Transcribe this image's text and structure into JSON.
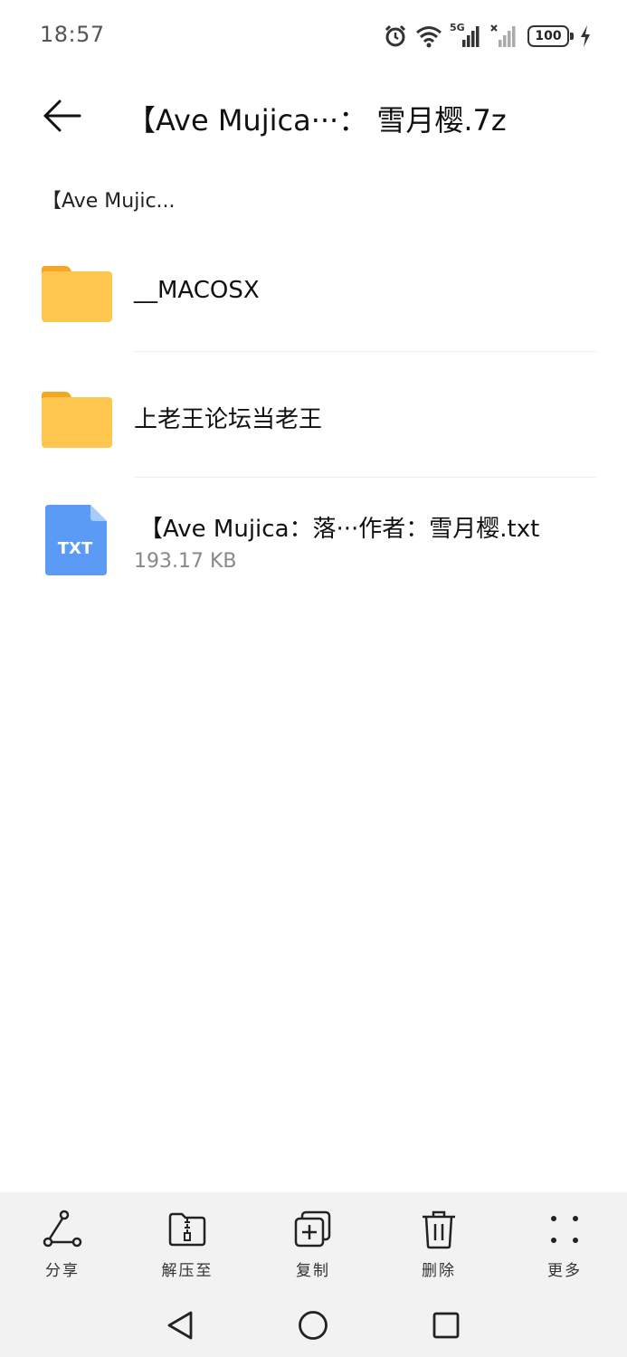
{
  "status_bar": {
    "time": "18:57",
    "network_label": "5G",
    "battery_level": "100",
    "icons": [
      "alarm-icon",
      "wifi-icon",
      "signal-5g-icon",
      "signal-no-service-icon",
      "battery-icon",
      "charging-icon"
    ]
  },
  "header": {
    "back_icon": "arrow-left-icon",
    "title": "【Ave Mujica···： 雪月樱.7z"
  },
  "breadcrumb": {
    "path": "【Ave Mujic..."
  },
  "files": [
    {
      "type": "folder",
      "icon": "folder-icon",
      "name": "__MACOSX"
    },
    {
      "type": "folder",
      "icon": "folder-icon",
      "name": "上老王论坛当老王"
    },
    {
      "type": "file",
      "icon": "txt-file-icon",
      "icon_label": "TXT",
      "name": "【Ave Mujica：落···作者：雪月樱.txt",
      "size": "193.17 KB"
    }
  ],
  "toolbar": {
    "share": "分享",
    "extract": "解压至",
    "copy": "复制",
    "delete": "删除",
    "more": "更多"
  },
  "navbar": {
    "icons": [
      "back-triangle-icon",
      "home-circle-icon",
      "recents-square-icon"
    ]
  },
  "colors": {
    "folder": "#FFC64F",
    "folder_tab": "#F5A623",
    "txt_icon": "#5B9BF5",
    "toolbar_bg": "#F2F2F2"
  }
}
